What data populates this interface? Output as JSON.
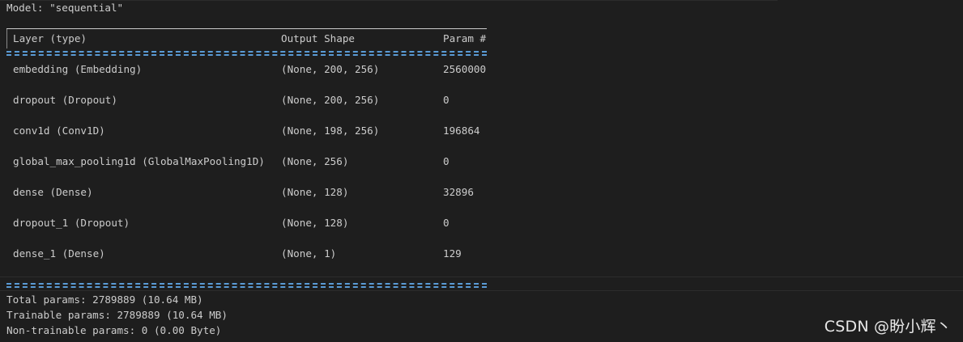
{
  "model_line": "Model: \"sequential\"",
  "header": {
    "layer": "Layer (type)",
    "output_shape": "Output Shape",
    "param": "Param #"
  },
  "rows": [
    {
      "layer": "embedding (Embedding)",
      "shape": "(None, 200, 256)",
      "param": "2560000"
    },
    {
      "layer": "dropout (Dropout)",
      "shape": "(None, 200, 256)",
      "param": "0"
    },
    {
      "layer": "conv1d (Conv1D)",
      "shape": "(None, 198, 256)",
      "param": "196864"
    },
    {
      "layer": "global_max_pooling1d (GlobalMaxPooling1D)",
      "shape": "(None, 256)",
      "param": "0"
    },
    {
      "layer": "dense (Dense)",
      "shape": "(None, 128)",
      "param": "32896"
    },
    {
      "layer": "dropout_1 (Dropout)",
      "shape": "(None, 128)",
      "param": "0"
    },
    {
      "layer": "dense_1 (Dense)",
      "shape": "(None, 1)",
      "param": "129"
    }
  ],
  "summary": {
    "total": "Total params: 2789889 (10.64 MB)",
    "trainable": "Trainable params: 2789889 (10.64 MB)",
    "non_trainable": "Non-trainable params: 0 (0.00 Byte)"
  },
  "watermark": "CSDN @盼小辉丶",
  "colors": {
    "background": "#1e1e1e",
    "text": "#cccccc",
    "rule_accent": "#5a9bd5"
  }
}
